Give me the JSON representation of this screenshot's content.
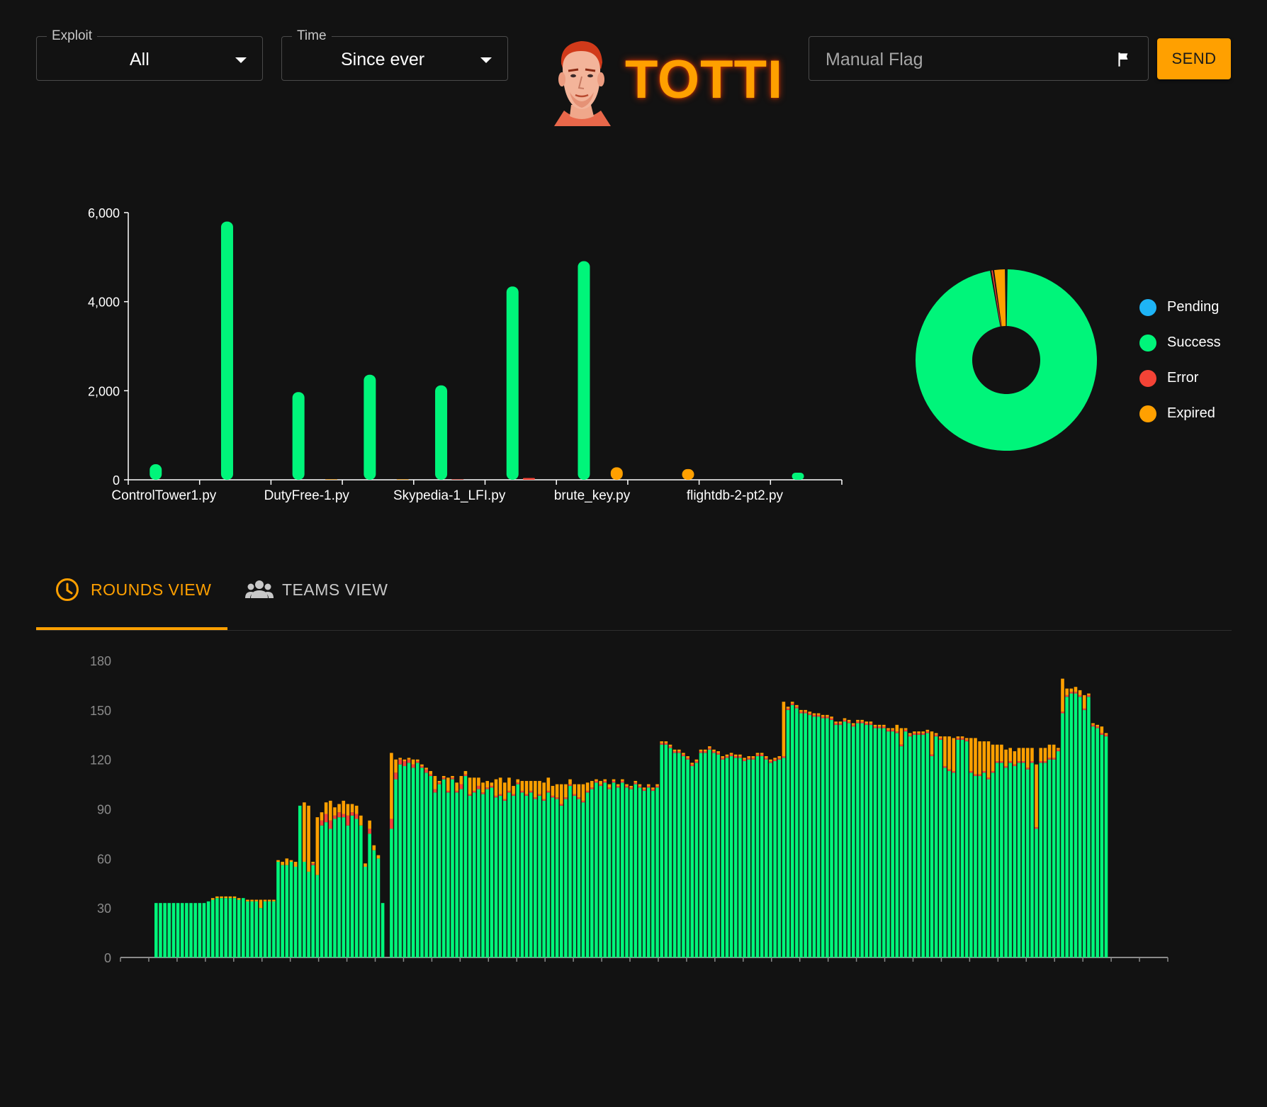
{
  "filters": {
    "exploit": {
      "label": "Exploit",
      "value": "All"
    },
    "time": {
      "label": "Time",
      "value": "Since ever"
    }
  },
  "brand": {
    "title": "TOTTI"
  },
  "manual_flag": {
    "placeholder": "Manual Flag",
    "send_label": "SEND"
  },
  "tabs": [
    {
      "label": "ROUNDS VIEW",
      "icon": "clock-icon",
      "active": true
    },
    {
      "label": "TEAMS VIEW",
      "icon": "people-icon",
      "active": false
    }
  ],
  "colors": {
    "pending": "#1eb4f6",
    "success": "#00f57a",
    "error": "#f44336",
    "expired": "#ffa000",
    "accent": "#ffa000",
    "background": "#121212"
  },
  "chart_data": [
    {
      "type": "bar",
      "title": "",
      "xlabel": "",
      "ylabel": "",
      "ylim": [
        0,
        6000
      ],
      "yticks": [
        "0",
        "2,000",
        "4,000",
        "6,000"
      ],
      "categories": [
        "ControlTower1.py",
        "",
        "DutyFree-1.py",
        "",
        "Skypedia-1_LFI.py",
        "",
        "brute_key.py",
        "",
        "flightdb-2-pt2.py",
        ""
      ],
      "series": [
        {
          "name": "Pending",
          "values": [
            0,
            0,
            0,
            0,
            0,
            0,
            0,
            0,
            0,
            0
          ]
        },
        {
          "name": "Success",
          "values": [
            350,
            5800,
            1970,
            2360,
            2120,
            4340,
            4910,
            0,
            0,
            160
          ]
        },
        {
          "name": "Error",
          "values": [
            0,
            0,
            0,
            0,
            10,
            40,
            0,
            0,
            0,
            0
          ]
        },
        {
          "name": "Expired",
          "values": [
            0,
            0,
            10,
            10,
            0,
            0,
            280,
            240,
            0,
            0
          ]
        }
      ],
      "legend_position": "none",
      "grid": false
    },
    {
      "type": "pie",
      "donut": true,
      "labels": [
        "Pending",
        "Success",
        "Error",
        "Expired"
      ],
      "values": [
        0,
        22290,
        60,
        540
      ],
      "legend_position": "right"
    },
    {
      "type": "bar",
      "stacked": true,
      "ylim": [
        0,
        180
      ],
      "yticks": [
        "0",
        "30",
        "60",
        "90",
        "120",
        "150",
        "180"
      ],
      "grid": false,
      "series_names": [
        "Success",
        "Error",
        "Expired"
      ],
      "segments": [
        [
          12,
          33,
          0,
          0
        ],
        [
          1,
          34,
          0,
          0
        ],
        [
          1,
          35,
          0,
          1
        ],
        [
          5,
          36,
          0,
          1
        ],
        [
          1,
          35,
          0,
          1
        ],
        [
          1,
          36,
          0,
          0
        ],
        [
          3,
          34,
          0,
          1
        ],
        [
          1,
          30,
          0,
          5
        ],
        [
          3,
          34,
          0,
          1
        ],
        [
          1,
          58,
          0,
          1
        ],
        [
          1,
          56,
          0,
          2
        ],
        [
          1,
          56,
          0,
          4
        ],
        [
          1,
          58,
          0,
          1
        ],
        [
          1,
          55,
          0,
          3
        ],
        [
          1,
          92,
          0,
          0
        ],
        [
          1,
          58,
          0,
          36
        ],
        [
          1,
          52,
          0,
          40
        ],
        [
          1,
          56,
          1,
          1
        ],
        [
          1,
          50,
          0,
          35
        ],
        [
          1,
          80,
          3,
          5
        ],
        [
          1,
          82,
          5,
          7
        ],
        [
          1,
          78,
          5,
          12
        ],
        [
          1,
          84,
          2,
          5
        ],
        [
          1,
          85,
          3,
          5
        ],
        [
          1,
          85,
          2,
          8
        ],
        [
          1,
          80,
          6,
          7
        ],
        [
          1,
          86,
          2,
          5
        ],
        [
          1,
          84,
          3,
          5
        ],
        [
          1,
          80,
          0,
          6
        ],
        [
          1,
          55,
          0,
          2
        ],
        [
          1,
          75,
          3,
          5
        ],
        [
          1,
          65,
          0,
          3
        ],
        [
          1,
          60,
          0,
          2
        ],
        [
          1,
          33,
          0,
          0
        ],
        [
          1,
          0,
          0,
          0
        ],
        [
          1,
          78,
          6,
          40
        ],
        [
          1,
          108,
          4,
          8
        ],
        [
          1,
          117,
          3,
          1
        ],
        [
          1,
          116,
          3,
          1
        ],
        [
          1,
          118,
          2,
          1
        ],
        [
          1,
          115,
          2,
          3
        ],
        [
          1,
          118,
          1,
          1
        ],
        [
          1,
          115,
          1,
          1
        ],
        [
          1,
          112,
          2,
          1
        ],
        [
          1,
          110,
          1,
          2
        ],
        [
          1,
          100,
          2,
          8
        ],
        [
          1,
          105,
          1,
          1
        ],
        [
          1,
          108,
          1,
          1
        ],
        [
          1,
          100,
          1,
          8
        ],
        [
          1,
          108,
          1,
          1
        ],
        [
          1,
          100,
          1,
          5
        ],
        [
          1,
          102,
          3,
          5
        ],
        [
          1,
          110,
          1,
          2
        ],
        [
          1,
          98,
          1,
          10
        ],
        [
          1,
          100,
          1,
          8
        ],
        [
          1,
          102,
          2,
          5
        ],
        [
          1,
          99,
          1,
          6
        ],
        [
          1,
          102,
          1,
          4
        ],
        [
          1,
          103,
          1,
          2
        ],
        [
          1,
          97,
          1,
          10
        ],
        [
          1,
          98,
          1,
          10
        ],
        [
          1,
          95,
          1,
          10
        ],
        [
          1,
          100,
          1,
          8
        ],
        [
          1,
          98,
          1,
          5
        ],
        [
          1,
          105,
          1,
          2
        ],
        [
          1,
          100,
          1,
          6
        ],
        [
          1,
          98,
          1,
          8
        ],
        [
          1,
          100,
          1,
          6
        ],
        [
          1,
          96,
          1,
          10
        ],
        [
          1,
          98,
          1,
          8
        ],
        [
          1,
          95,
          1,
          10
        ],
        [
          1,
          100,
          1,
          8
        ],
        [
          1,
          97,
          1,
          6
        ],
        [
          1,
          96,
          1,
          8
        ],
        [
          1,
          92,
          1,
          12
        ],
        [
          1,
          96,
          1,
          8
        ],
        [
          1,
          104,
          1,
          3
        ],
        [
          1,
          98,
          1,
          6
        ],
        [
          1,
          96,
          1,
          8
        ],
        [
          1,
          94,
          1,
          10
        ],
        [
          1,
          100,
          1,
          5
        ],
        [
          1,
          102,
          1,
          4
        ],
        [
          1,
          106,
          1,
          1
        ],
        [
          1,
          104,
          1,
          2
        ],
        [
          1,
          106,
          1,
          1
        ],
        [
          1,
          102,
          1,
          2
        ],
        [
          1,
          106,
          1,
          1
        ],
        [
          1,
          103,
          1,
          1
        ],
        [
          1,
          106,
          1,
          1
        ],
        [
          1,
          103,
          1,
          1
        ],
        [
          1,
          102,
          1,
          1
        ],
        [
          1,
          105,
          1,
          1
        ],
        [
          1,
          103,
          1,
          1
        ],
        [
          1,
          101,
          1,
          1
        ],
        [
          1,
          103,
          1,
          1
        ],
        [
          1,
          101,
          1,
          1
        ],
        [
          1,
          103,
          1,
          1
        ],
        [
          1,
          129,
          1,
          1
        ],
        [
          1,
          129,
          1,
          1
        ],
        [
          1,
          127,
          1,
          1
        ],
        [
          1,
          124,
          1,
          1
        ],
        [
          1,
          124,
          1,
          1
        ],
        [
          1,
          122,
          1,
          1
        ],
        [
          1,
          120,
          1,
          1
        ],
        [
          1,
          116,
          1,
          1
        ],
        [
          1,
          118,
          1,
          1
        ],
        [
          1,
          124,
          1,
          1
        ],
        [
          1,
          124,
          1,
          1
        ],
        [
          1,
          126,
          1,
          1
        ],
        [
          1,
          124,
          1,
          1
        ],
        [
          1,
          123,
          1,
          1
        ],
        [
          1,
          120,
          1,
          1
        ],
        [
          1,
          121,
          1,
          1
        ],
        [
          1,
          122,
          1,
          1
        ],
        [
          1,
          121,
          1,
          1
        ],
        [
          1,
          121,
          1,
          1
        ],
        [
          1,
          119,
          1,
          1
        ],
        [
          1,
          120,
          1,
          1
        ],
        [
          1,
          120,
          1,
          1
        ],
        [
          1,
          122,
          1,
          1
        ],
        [
          1,
          122,
          1,
          1
        ],
        [
          1,
          120,
          1,
          1
        ],
        [
          1,
          118,
          1,
          1
        ],
        [
          1,
          119,
          1,
          1
        ],
        [
          1,
          120,
          1,
          1
        ],
        [
          1,
          121,
          1,
          33
        ],
        [
          1,
          150,
          1,
          1
        ],
        [
          1,
          153,
          1,
          1
        ],
        [
          1,
          151,
          1,
          1
        ],
        [
          1,
          148,
          1,
          1
        ],
        [
          1,
          148,
          1,
          1
        ],
        [
          1,
          147,
          1,
          1
        ],
        [
          1,
          146,
          1,
          1
        ],
        [
          1,
          146,
          1,
          1
        ],
        [
          1,
          145,
          1,
          1
        ],
        [
          1,
          145,
          1,
          1
        ],
        [
          1,
          144,
          1,
          1
        ],
        [
          1,
          141,
          1,
          1
        ],
        [
          1,
          141,
          1,
          1
        ],
        [
          1,
          143,
          1,
          1
        ],
        [
          1,
          142,
          1,
          1
        ],
        [
          1,
          140,
          1,
          1
        ],
        [
          1,
          142,
          1,
          1
        ],
        [
          1,
          142,
          1,
          1
        ],
        [
          1,
          141,
          1,
          1
        ],
        [
          1,
          141,
          1,
          1
        ],
        [
          1,
          139,
          1,
          1
        ],
        [
          1,
          139,
          1,
          1
        ],
        [
          1,
          139,
          1,
          1
        ],
        [
          1,
          137,
          1,
          1
        ],
        [
          1,
          137,
          1,
          1
        ],
        [
          1,
          136,
          1,
          4
        ],
        [
          1,
          128,
          1,
          10
        ],
        [
          1,
          137,
          1,
          1
        ],
        [
          1,
          134,
          1,
          1
        ],
        [
          1,
          135,
          1,
          1
        ],
        [
          1,
          135,
          1,
          1
        ],
        [
          1,
          135,
          1,
          1
        ],
        [
          1,
          136,
          1,
          1
        ],
        [
          1,
          122,
          1,
          14
        ],
        [
          1,
          134,
          1,
          1
        ],
        [
          1,
          132,
          1,
          1
        ],
        [
          1,
          115,
          1,
          18
        ],
        [
          1,
          113,
          1,
          20
        ],
        [
          1,
          112,
          1,
          20
        ],
        [
          1,
          132,
          1,
          1
        ],
        [
          1,
          132,
          1,
          1
        ],
        [
          1,
          131,
          1,
          1
        ],
        [
          1,
          112,
          1,
          20
        ],
        [
          1,
          110,
          1,
          22
        ],
        [
          1,
          110,
          1,
          20
        ],
        [
          1,
          112,
          1,
          18
        ],
        [
          1,
          108,
          1,
          22
        ],
        [
          1,
          112,
          1,
          16
        ],
        [
          1,
          118,
          1,
          10
        ],
        [
          1,
          118,
          1,
          10
        ],
        [
          1,
          115,
          1,
          10
        ],
        [
          1,
          118,
          1,
          8
        ],
        [
          1,
          116,
          1,
          8
        ],
        [
          1,
          118,
          1,
          8
        ],
        [
          1,
          118,
          1,
          8
        ],
        [
          1,
          114,
          1,
          12
        ],
        [
          1,
          118,
          1,
          8
        ],
        [
          1,
          78,
          1,
          38
        ],
        [
          1,
          118,
          1,
          8
        ],
        [
          1,
          118,
          1,
          8
        ],
        [
          1,
          120,
          1,
          8
        ],
        [
          1,
          120,
          1,
          8
        ],
        [
          1,
          125,
          1,
          1
        ],
        [
          1,
          148,
          1,
          20
        ],
        [
          1,
          158,
          1,
          4
        ],
        [
          1,
          160,
          1,
          2
        ],
        [
          1,
          160,
          1,
          3
        ],
        [
          1,
          158,
          1,
          3
        ],
        [
          1,
          150,
          1,
          8
        ],
        [
          1,
          158,
          1,
          1
        ],
        [
          1,
          140,
          1,
          1
        ],
        [
          1,
          139,
          1,
          1
        ],
        [
          1,
          135,
          1,
          4
        ],
        [
          1,
          134,
          1,
          1
        ]
      ]
    }
  ]
}
